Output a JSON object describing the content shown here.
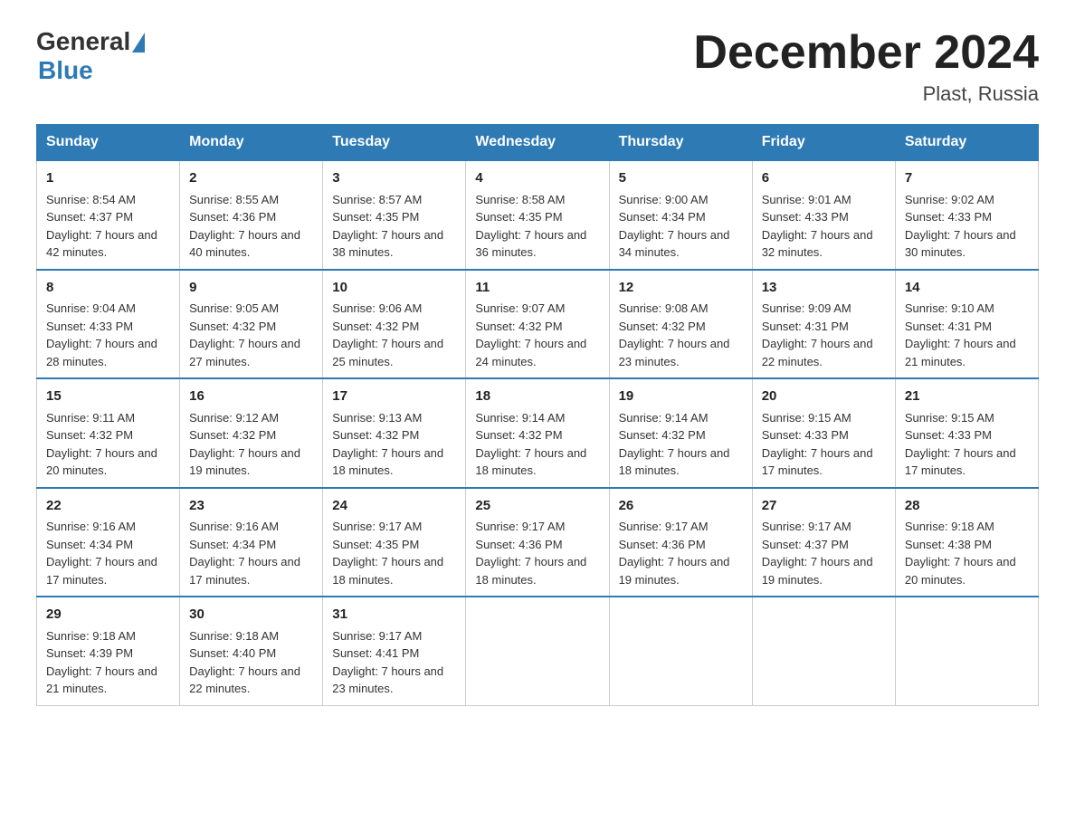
{
  "header": {
    "logo_general": "General",
    "logo_blue": "Blue",
    "month_title": "December 2024",
    "location": "Plast, Russia"
  },
  "days_of_week": [
    "Sunday",
    "Monday",
    "Tuesday",
    "Wednesday",
    "Thursday",
    "Friday",
    "Saturday"
  ],
  "weeks": [
    [
      {
        "day": "1",
        "sunrise": "Sunrise: 8:54 AM",
        "sunset": "Sunset: 4:37 PM",
        "daylight": "Daylight: 7 hours and 42 minutes."
      },
      {
        "day": "2",
        "sunrise": "Sunrise: 8:55 AM",
        "sunset": "Sunset: 4:36 PM",
        "daylight": "Daylight: 7 hours and 40 minutes."
      },
      {
        "day": "3",
        "sunrise": "Sunrise: 8:57 AM",
        "sunset": "Sunset: 4:35 PM",
        "daylight": "Daylight: 7 hours and 38 minutes."
      },
      {
        "day": "4",
        "sunrise": "Sunrise: 8:58 AM",
        "sunset": "Sunset: 4:35 PM",
        "daylight": "Daylight: 7 hours and 36 minutes."
      },
      {
        "day": "5",
        "sunrise": "Sunrise: 9:00 AM",
        "sunset": "Sunset: 4:34 PM",
        "daylight": "Daylight: 7 hours and 34 minutes."
      },
      {
        "day": "6",
        "sunrise": "Sunrise: 9:01 AM",
        "sunset": "Sunset: 4:33 PM",
        "daylight": "Daylight: 7 hours and 32 minutes."
      },
      {
        "day": "7",
        "sunrise": "Sunrise: 9:02 AM",
        "sunset": "Sunset: 4:33 PM",
        "daylight": "Daylight: 7 hours and 30 minutes."
      }
    ],
    [
      {
        "day": "8",
        "sunrise": "Sunrise: 9:04 AM",
        "sunset": "Sunset: 4:33 PM",
        "daylight": "Daylight: 7 hours and 28 minutes."
      },
      {
        "day": "9",
        "sunrise": "Sunrise: 9:05 AM",
        "sunset": "Sunset: 4:32 PM",
        "daylight": "Daylight: 7 hours and 27 minutes."
      },
      {
        "day": "10",
        "sunrise": "Sunrise: 9:06 AM",
        "sunset": "Sunset: 4:32 PM",
        "daylight": "Daylight: 7 hours and 25 minutes."
      },
      {
        "day": "11",
        "sunrise": "Sunrise: 9:07 AM",
        "sunset": "Sunset: 4:32 PM",
        "daylight": "Daylight: 7 hours and 24 minutes."
      },
      {
        "day": "12",
        "sunrise": "Sunrise: 9:08 AM",
        "sunset": "Sunset: 4:32 PM",
        "daylight": "Daylight: 7 hours and 23 minutes."
      },
      {
        "day": "13",
        "sunrise": "Sunrise: 9:09 AM",
        "sunset": "Sunset: 4:31 PM",
        "daylight": "Daylight: 7 hours and 22 minutes."
      },
      {
        "day": "14",
        "sunrise": "Sunrise: 9:10 AM",
        "sunset": "Sunset: 4:31 PM",
        "daylight": "Daylight: 7 hours and 21 minutes."
      }
    ],
    [
      {
        "day": "15",
        "sunrise": "Sunrise: 9:11 AM",
        "sunset": "Sunset: 4:32 PM",
        "daylight": "Daylight: 7 hours and 20 minutes."
      },
      {
        "day": "16",
        "sunrise": "Sunrise: 9:12 AM",
        "sunset": "Sunset: 4:32 PM",
        "daylight": "Daylight: 7 hours and 19 minutes."
      },
      {
        "day": "17",
        "sunrise": "Sunrise: 9:13 AM",
        "sunset": "Sunset: 4:32 PM",
        "daylight": "Daylight: 7 hours and 18 minutes."
      },
      {
        "day": "18",
        "sunrise": "Sunrise: 9:14 AM",
        "sunset": "Sunset: 4:32 PM",
        "daylight": "Daylight: 7 hours and 18 minutes."
      },
      {
        "day": "19",
        "sunrise": "Sunrise: 9:14 AM",
        "sunset": "Sunset: 4:32 PM",
        "daylight": "Daylight: 7 hours and 18 minutes."
      },
      {
        "day": "20",
        "sunrise": "Sunrise: 9:15 AM",
        "sunset": "Sunset: 4:33 PM",
        "daylight": "Daylight: 7 hours and 17 minutes."
      },
      {
        "day": "21",
        "sunrise": "Sunrise: 9:15 AM",
        "sunset": "Sunset: 4:33 PM",
        "daylight": "Daylight: 7 hours and 17 minutes."
      }
    ],
    [
      {
        "day": "22",
        "sunrise": "Sunrise: 9:16 AM",
        "sunset": "Sunset: 4:34 PM",
        "daylight": "Daylight: 7 hours and 17 minutes."
      },
      {
        "day": "23",
        "sunrise": "Sunrise: 9:16 AM",
        "sunset": "Sunset: 4:34 PM",
        "daylight": "Daylight: 7 hours and 17 minutes."
      },
      {
        "day": "24",
        "sunrise": "Sunrise: 9:17 AM",
        "sunset": "Sunset: 4:35 PM",
        "daylight": "Daylight: 7 hours and 18 minutes."
      },
      {
        "day": "25",
        "sunrise": "Sunrise: 9:17 AM",
        "sunset": "Sunset: 4:36 PM",
        "daylight": "Daylight: 7 hours and 18 minutes."
      },
      {
        "day": "26",
        "sunrise": "Sunrise: 9:17 AM",
        "sunset": "Sunset: 4:36 PM",
        "daylight": "Daylight: 7 hours and 19 minutes."
      },
      {
        "day": "27",
        "sunrise": "Sunrise: 9:17 AM",
        "sunset": "Sunset: 4:37 PM",
        "daylight": "Daylight: 7 hours and 19 minutes."
      },
      {
        "day": "28",
        "sunrise": "Sunrise: 9:18 AM",
        "sunset": "Sunset: 4:38 PM",
        "daylight": "Daylight: 7 hours and 20 minutes."
      }
    ],
    [
      {
        "day": "29",
        "sunrise": "Sunrise: 9:18 AM",
        "sunset": "Sunset: 4:39 PM",
        "daylight": "Daylight: 7 hours and 21 minutes."
      },
      {
        "day": "30",
        "sunrise": "Sunrise: 9:18 AM",
        "sunset": "Sunset: 4:40 PM",
        "daylight": "Daylight: 7 hours and 22 minutes."
      },
      {
        "day": "31",
        "sunrise": "Sunrise: 9:17 AM",
        "sunset": "Sunset: 4:41 PM",
        "daylight": "Daylight: 7 hours and 23 minutes."
      },
      null,
      null,
      null,
      null
    ]
  ]
}
